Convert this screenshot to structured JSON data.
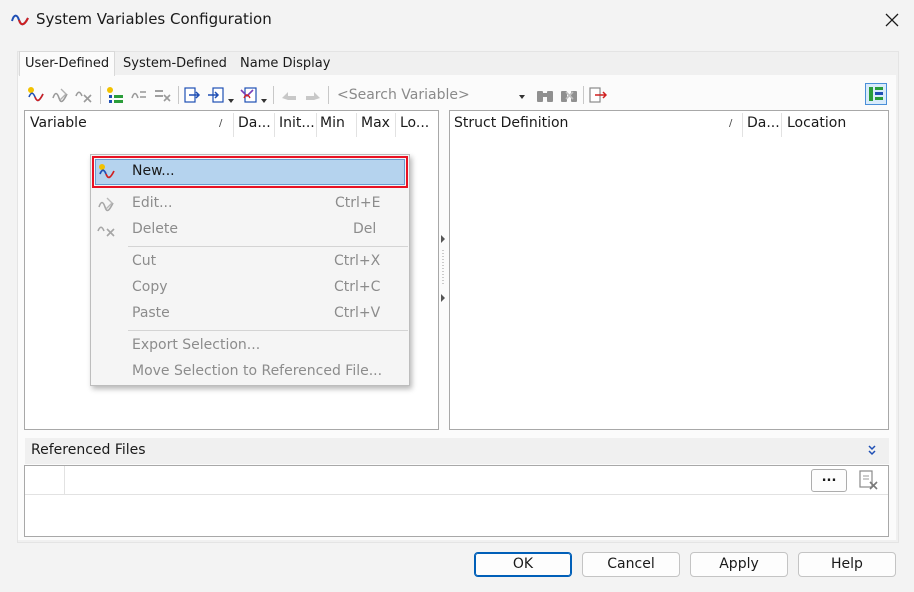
{
  "window": {
    "title": "System Variables Configuration"
  },
  "tabs": [
    {
      "label": "User-Defined",
      "active": true
    },
    {
      "label": "System-Defined",
      "active": false
    },
    {
      "label": "Name Display",
      "active": false
    }
  ],
  "toolbar": {
    "search_placeholder": "<Search Variable>",
    "icons": [
      "new-variable-icon",
      "edit-variable-icon",
      "delete-variable-icon",
      "new-struct-icon",
      "edit-struct-icon",
      "delete-struct-icon",
      "export-icon",
      "import-icon",
      "filter-icon",
      "move-up-icon",
      "move-down-icon",
      "find-icon",
      "find-clear-icon",
      "export-selection-icon",
      "layout-toggle-icon"
    ]
  },
  "variables_table": {
    "columns": [
      "Variable",
      "Da...",
      "Init...",
      "Min",
      "Max",
      "Lo..."
    ]
  },
  "struct_table": {
    "columns": [
      "Struct Definition",
      "Da...",
      "Location"
    ]
  },
  "context_menu": {
    "items": [
      {
        "label": "New...",
        "shortcut": "",
        "enabled": true,
        "highlighted": true
      },
      {
        "label": "Edit...",
        "shortcut": "Ctrl+E",
        "enabled": false
      },
      {
        "label": "Delete",
        "shortcut": "Del",
        "enabled": false
      },
      {
        "label": "Cut",
        "shortcut": "Ctrl+X",
        "enabled": false
      },
      {
        "label": "Copy",
        "shortcut": "Ctrl+C",
        "enabled": false
      },
      {
        "label": "Paste",
        "shortcut": "Ctrl+V",
        "enabled": false
      },
      {
        "label": "Export Selection...",
        "shortcut": "",
        "enabled": false
      },
      {
        "label": "Move Selection to Referenced File...",
        "shortcut": "",
        "enabled": false
      }
    ]
  },
  "referenced_files": {
    "title": "Referenced Files",
    "browse_label": "..."
  },
  "buttons": {
    "ok": "OK",
    "cancel": "Cancel",
    "apply": "Apply",
    "help": "Help"
  },
  "colors": {
    "highlight_border": "#e81123",
    "selection": "#b5d3ee",
    "accent": "#005fb8"
  }
}
